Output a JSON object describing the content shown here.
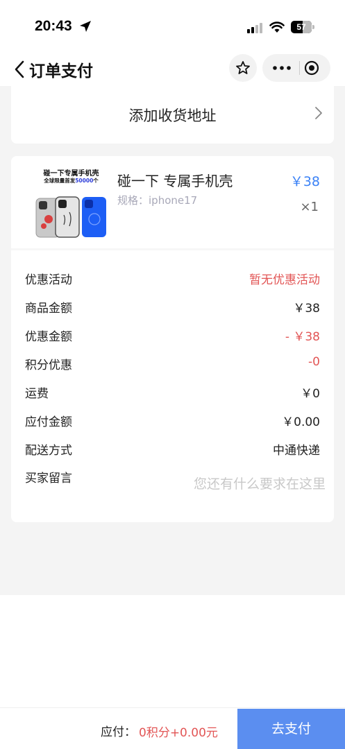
{
  "status_bar": {
    "time": "20:43",
    "battery": "57",
    "battery_level": 0.57,
    "icons": [
      "location-arrow-icon",
      "signal-icon",
      "wifi-icon",
      "battery-icon"
    ]
  },
  "nav": {
    "title": "订单支付",
    "icons": [
      "chevron-left-icon",
      "star-icon",
      "more-icon",
      "close-circle-icon"
    ]
  },
  "address": {
    "label": "添加收货地址"
  },
  "product": {
    "image": {
      "title": "碰一下专属手机壳",
      "line1_prefix": "全球限量首发",
      "line1_highlight": "50000",
      "line1_suffix": "个"
    },
    "name": "碰一下 专属手机壳",
    "spec": "规格：iphone17",
    "price": "￥38",
    "qty": "×1"
  },
  "summary": [
    {
      "label": "优惠活动",
      "value": "暂无优惠活动",
      "style": "red"
    },
    {
      "label": "商品金额",
      "value": "￥38",
      "style": "normal"
    },
    {
      "label": "优惠金额",
      "value": "- ￥38",
      "style": "red"
    },
    {
      "label": "积分优惠",
      "value": "-0",
      "style": "red"
    },
    {
      "label": "运费",
      "value": "￥0",
      "style": "normal"
    },
    {
      "label": "应付金额",
      "value": "￥0.00",
      "style": "normal"
    },
    {
      "label": "配送方式",
      "value": "中通快递",
      "style": "normal"
    }
  ],
  "message": {
    "label": "买家留言",
    "placeholder": "您还有什么要求在这里"
  },
  "footer": {
    "pay_label": "应付：",
    "pay_amount": "0积分+0.00元",
    "pay_button": "去支付"
  },
  "colors": {
    "accent_blue": "#5b8ef0",
    "price_blue": "#3b82f6",
    "discount_red": "#e25555",
    "background_gray": "#f4f4f4"
  }
}
